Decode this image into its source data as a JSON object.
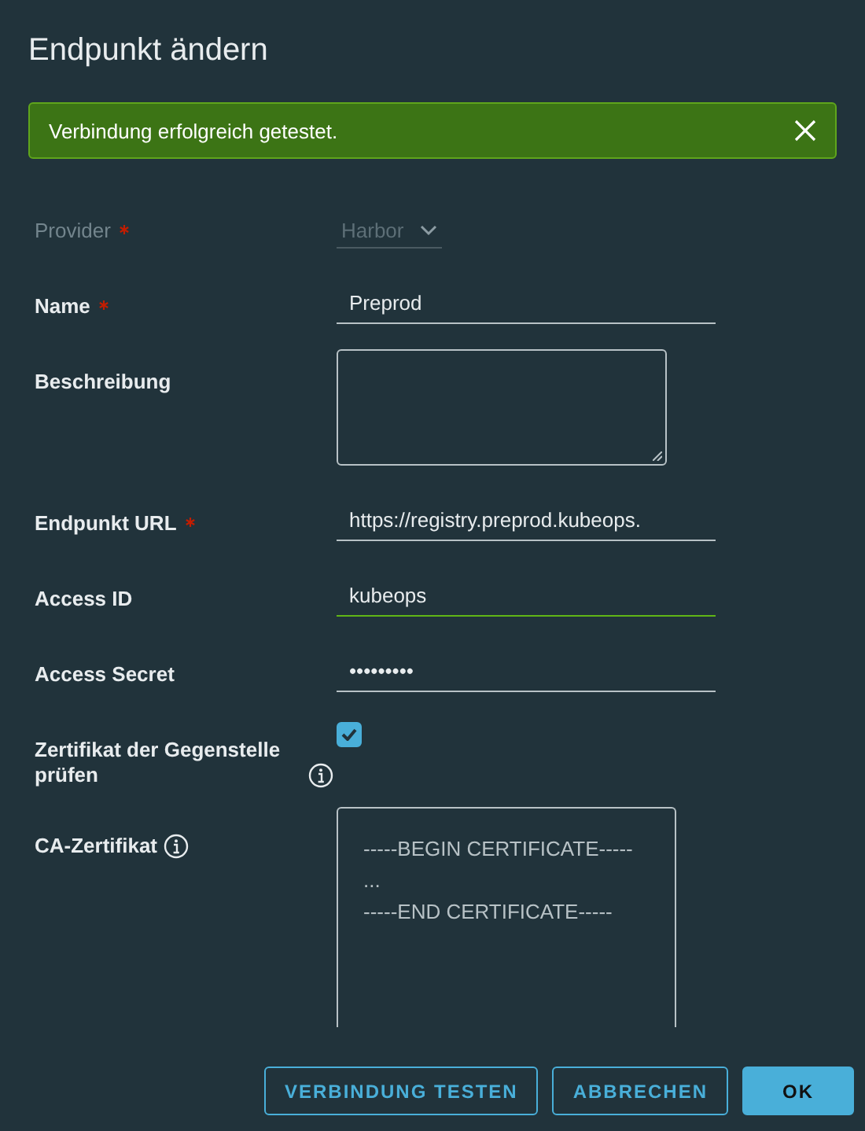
{
  "dialog": {
    "title": "Endpunkt ändern"
  },
  "alert": {
    "message": "Verbindung erfolgreich getestet."
  },
  "fields": [
    {
      "kind": "select",
      "label": "Provider",
      "required": true,
      "disabled": true,
      "info": false,
      "value": "Harbor"
    },
    {
      "kind": "text",
      "label": "Name",
      "required": true,
      "info": false,
      "value": "Preprod",
      "focused": false
    },
    {
      "kind": "textarea",
      "label": "Beschreibung",
      "required": false,
      "info": false
    },
    {
      "kind": "text",
      "label": "Endpunkt URL",
      "required": true,
      "info": false,
      "value": "https://registry.preprod.kubeops.",
      "focused": false
    },
    {
      "kind": "text",
      "label": "Access ID",
      "required": false,
      "info": false,
      "value": "kubeops",
      "focused": true
    },
    {
      "kind": "text",
      "label": "Access Secret",
      "required": false,
      "info": false,
      "value": "•••••••••",
      "focused": false
    },
    {
      "kind": "checkbox",
      "label": "Zertifikat der Gegenstelle prüfen",
      "required": false,
      "info": true,
      "checked": true
    },
    {
      "kind": "certificate",
      "label": "CA-Zertifikat",
      "required": false,
      "info": true,
      "lines": [
        "-----BEGIN CERTIFICATE-----",
        "...",
        "-----END CERTIFICATE-----"
      ]
    }
  ],
  "buttons": [
    {
      "label": "VERBINDUNG TESTEN",
      "kind": "outline"
    },
    {
      "label": "ABBRECHEN",
      "kind": "outline"
    },
    {
      "label": "OK",
      "kind": "primary"
    }
  ]
}
